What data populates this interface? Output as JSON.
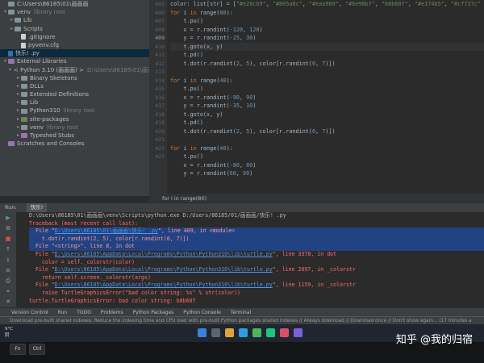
{
  "project_tree": [
    {
      "indent": 0,
      "arrow": "",
      "icon": "folder",
      "label": "C:\\Users\\86185\\01\\画画画",
      "muted": ""
    },
    {
      "indent": 0,
      "arrow": "▾",
      "icon": "folder",
      "label": "venv",
      "muted": "library root"
    },
    {
      "indent": 1,
      "arrow": "▸",
      "icon": "folder",
      "label": "Lib",
      "muted": ""
    },
    {
      "indent": 1,
      "arrow": "▸",
      "icon": "folder",
      "label": "Scripts",
      "muted": ""
    },
    {
      "indent": 2,
      "arrow": "",
      "icon": "file",
      "label": ".gitignore",
      "muted": ""
    },
    {
      "indent": 2,
      "arrow": "",
      "icon": "file",
      "label": "pyvenv.cfg",
      "muted": ""
    },
    {
      "indent": 0,
      "arrow": "",
      "icon": "py",
      "label": "快乐! .py",
      "muted": "",
      "selected": true
    },
    {
      "indent": 0,
      "arrow": "▾",
      "icon": "lib",
      "label": "External Libraries",
      "muted": ""
    },
    {
      "indent": 1,
      "arrow": "▾",
      "icon": "lib",
      "label": "< Python 3.10 (画画画) >",
      "muted": "D:\\Users\\86185\\01\\画画画"
    },
    {
      "indent": 2,
      "arrow": "▸",
      "icon": "folder",
      "label": "Binary Skeletons",
      "muted": ""
    },
    {
      "indent": 2,
      "arrow": "▸",
      "icon": "folder",
      "label": "DLLs",
      "muted": ""
    },
    {
      "indent": 2,
      "arrow": "▸",
      "icon": "folder",
      "label": "Extended Definitions",
      "muted": ""
    },
    {
      "indent": 2,
      "arrow": "▸",
      "icon": "folder",
      "label": "Lib",
      "muted": ""
    },
    {
      "indent": 2,
      "arrow": "▸",
      "icon": "folder",
      "label": "Python310",
      "muted": "library root"
    },
    {
      "indent": 2,
      "arrow": "▸",
      "icon": "pkg",
      "label": "site-packages",
      "muted": ""
    },
    {
      "indent": 2,
      "arrow": "▸",
      "icon": "folder",
      "label": "venv",
      "muted": "library root"
    },
    {
      "indent": 2,
      "arrow": "▸",
      "icon": "lib",
      "label": "Typeshed Stubs",
      "muted": ""
    },
    {
      "indent": 0,
      "arrow": "",
      "icon": "lib",
      "label": "Scratches and Consoles",
      "muted": ""
    }
  ],
  "line_numbers": [
    "405",
    "406",
    "407",
    "408",
    "409",
    "410",
    "411",
    "412",
    "413",
    "414",
    "415",
    "416",
    "417",
    "418",
    "419",
    "420",
    "421",
    "422",
    "423"
  ],
  "active_line": "409",
  "code_lines": [
    [
      {
        "t": "color: list[str] = [",
        "c": ""
      },
      {
        "t": "\"#e28cb9\"",
        "c": "str"
      },
      {
        "t": ", ",
        "c": ""
      },
      {
        "t": "\"#805a8c\"",
        "c": "str"
      },
      {
        "t": ", ",
        "c": ""
      },
      {
        "t": "\"#eaa989\"",
        "c": "str"
      },
      {
        "t": ", ",
        "c": ""
      },
      {
        "t": "\"#6e90b7\"",
        "c": "str"
      },
      {
        "t": ", ",
        "c": ""
      },
      {
        "t": "\"b8b68f\"",
        "c": "str"
      },
      {
        "t": ", ",
        "c": ""
      },
      {
        "t": "\"#e174b5\"",
        "c": "str"
      },
      {
        "t": ", ",
        "c": ""
      },
      {
        "t": "\"#cf737c\"",
        "c": "str"
      }
    ],
    [
      {
        "t": "for ",
        "c": "kw"
      },
      {
        "t": "i ",
        "c": ""
      },
      {
        "t": "in ",
        "c": "kw"
      },
      {
        "t": "range(",
        "c": ""
      },
      {
        "t": "80",
        "c": "num"
      },
      {
        "t": "):",
        "c": ""
      }
    ],
    [
      {
        "t": "    t.pu()",
        "c": ""
      }
    ],
    [
      {
        "t": "    x = r.randint(",
        "c": ""
      },
      {
        "t": "-120",
        "c": "num"
      },
      {
        "t": ", ",
        "c": ""
      },
      {
        "t": "120",
        "c": "num"
      },
      {
        "t": ")",
        "c": ""
      }
    ],
    [
      {
        "t": "    y = r.randint(",
        "c": ""
      },
      {
        "t": "-25",
        "c": "num"
      },
      {
        "t": ", ",
        "c": ""
      },
      {
        "t": "30",
        "c": "num"
      },
      {
        "t": ")",
        "c": ""
      }
    ],
    [
      {
        "t": "    t.goto(x, y)",
        "c": ""
      }
    ],
    [
      {
        "t": "    t.pd()",
        "c": ""
      }
    ],
    [
      {
        "t": "    t.dot(r.randint(",
        "c": ""
      },
      {
        "t": "2",
        "c": "num"
      },
      {
        "t": ", ",
        "c": ""
      },
      {
        "t": "5",
        "c": "num"
      },
      {
        "t": "), color[r.randint(",
        "c": ""
      },
      {
        "t": "0",
        "c": "num"
      },
      {
        "t": ", ",
        "c": ""
      },
      {
        "t": "7",
        "c": "num"
      },
      {
        "t": ")])",
        "c": ""
      }
    ],
    [
      {
        "t": "",
        "c": ""
      }
    ],
    [
      {
        "t": "for ",
        "c": "kw"
      },
      {
        "t": "i ",
        "c": ""
      },
      {
        "t": "in ",
        "c": "kw"
      },
      {
        "t": "range(",
        "c": ""
      },
      {
        "t": "40",
        "c": "num"
      },
      {
        "t": "):",
        "c": ""
      }
    ],
    [
      {
        "t": "    t.pu()",
        "c": ""
      }
    ],
    [
      {
        "t": "    x = r.randint(",
        "c": ""
      },
      {
        "t": "-90",
        "c": "num"
      },
      {
        "t": ", ",
        "c": ""
      },
      {
        "t": "90",
        "c": "num"
      },
      {
        "t": ")",
        "c": ""
      }
    ],
    [
      {
        "t": "    y = r.randint(",
        "c": ""
      },
      {
        "t": "-35",
        "c": "num"
      },
      {
        "t": ", ",
        "c": ""
      },
      {
        "t": "10",
        "c": "num"
      },
      {
        "t": ")",
        "c": ""
      }
    ],
    [
      {
        "t": "    t.goto(x, y)",
        "c": ""
      }
    ],
    [
      {
        "t": "    t.pd()",
        "c": ""
      }
    ],
    [
      {
        "t": "    t.dot(r.randint(",
        "c": ""
      },
      {
        "t": "2",
        "c": "num"
      },
      {
        "t": ", ",
        "c": ""
      },
      {
        "t": "5",
        "c": "num"
      },
      {
        "t": "), color[r.randint(",
        "c": ""
      },
      {
        "t": "0",
        "c": "num"
      },
      {
        "t": ", ",
        "c": ""
      },
      {
        "t": "7",
        "c": "num"
      },
      {
        "t": ")])",
        "c": ""
      }
    ],
    [
      {
        "t": "",
        "c": ""
      }
    ],
    [
      {
        "t": "for ",
        "c": "kw"
      },
      {
        "t": "i ",
        "c": ""
      },
      {
        "t": "in ",
        "c": "kw"
      },
      {
        "t": "range(",
        "c": ""
      },
      {
        "t": "40",
        "c": "num"
      },
      {
        "t": "):",
        "c": ""
      }
    ],
    [
      {
        "t": "    t.pu()",
        "c": ""
      }
    ],
    [
      {
        "t": "    x = r.randint(",
        "c": ""
      },
      {
        "t": "-80",
        "c": "num"
      },
      {
        "t": ", ",
        "c": ""
      },
      {
        "t": "80",
        "c": "num"
      },
      {
        "t": ")",
        "c": ""
      }
    ],
    [
      {
        "t": "    y = r.randint(",
        "c": ""
      },
      {
        "t": "60",
        "c": "num"
      },
      {
        "t": ", ",
        "c": ""
      },
      {
        "t": "90",
        "c": "num"
      },
      {
        "t": ")",
        "c": ""
      }
    ]
  ],
  "breadcrumb": "for i in range(80)",
  "run_header": {
    "label": "Run:",
    "tab": "快乐!"
  },
  "console_lines": [
    {
      "kind": "cmd",
      "text": "D:\\Users\\86185\\01\\画画画\\venv\\Scripts\\python.exe D:/Users/86185/01/画画画/快乐! .py"
    },
    {
      "kind": "err",
      "text": "Traceback (most recent call last):"
    },
    {
      "kind": "hl",
      "pre": "  File \"",
      "path": "D:\\Users\\86185\\01\\画画画\\快乐! .py",
      "post": "\", line 409, in <module>"
    },
    {
      "kind": "hl",
      "text": "    t.dot(r.randint(2, 5), color[r.randint(0, 7)])"
    },
    {
      "kind": "hl",
      "text": "  File \"<string>\", line 8, in dot"
    },
    {
      "kind": "err",
      "pre": "  File \"",
      "path": "D:\\Users\\86185\\AppData\\Local\\Programs\\Python\\Python310\\lib\\turtle.py",
      "post": "\", line 3378, in dot"
    },
    {
      "kind": "err",
      "text": "    color = self._colorstr(color)"
    },
    {
      "kind": "err",
      "pre": "  File \"",
      "path": "D:\\Users\\86185\\AppData\\Local\\Programs\\Python\\Python310\\lib\\turtle.py",
      "post": "\", line 2697, in _colorstr"
    },
    {
      "kind": "err",
      "text": "    return self.screen._colorstr(args)"
    },
    {
      "kind": "err",
      "pre": "  File \"",
      "path": "D:\\Users\\86185\\AppData\\Local\\Programs\\Python\\Python310\\lib\\turtle.py",
      "post": "\", line 1159, in _colorstr"
    },
    {
      "kind": "err",
      "text": "    raise TurtleGraphicsError(\"bad color string: %s\" % str(color))"
    },
    {
      "kind": "err",
      "text": "turtle.TurtleGraphicsError: bad color string: b8b68f"
    }
  ],
  "tool_tabs": [
    "Version Control",
    "Run",
    "TODO",
    "Problems",
    "Python Packages",
    "Python Console",
    "Terminal"
  ],
  "status": "Download pre-built shared indexes: Reduce the indexing time and CPU load with pre-built Python packages shared indexes // Always download // Download once // Don't show again... (17 minutes a",
  "taskbar": {
    "temp": "9°C",
    "weather": "阴"
  },
  "keys": [
    "Fn",
    "Ctrl"
  ],
  "watermark": "知乎 @我的归宿"
}
